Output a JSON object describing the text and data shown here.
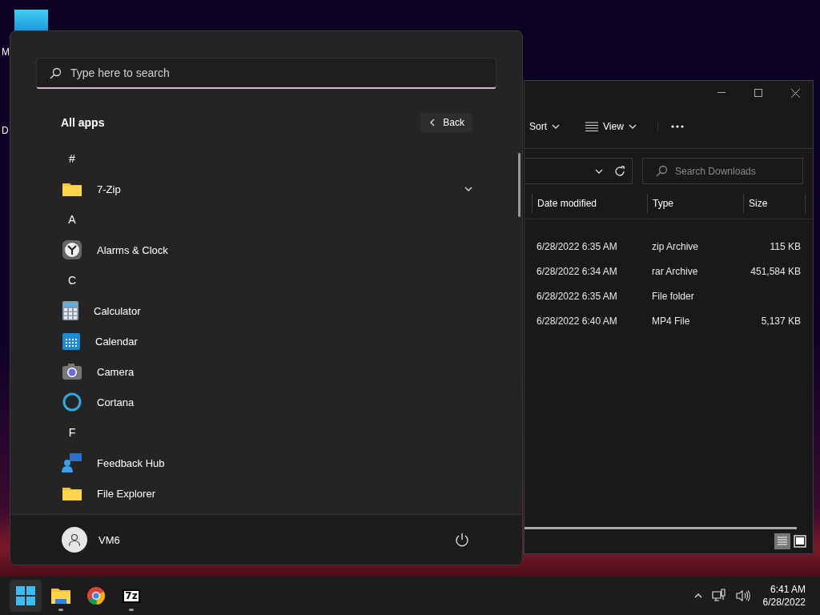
{
  "desktop": {
    "icons": [
      {
        "label": "M"
      },
      {
        "label": "D"
      }
    ]
  },
  "start_menu": {
    "search": {
      "placeholder": "Type here to search"
    },
    "title": "All apps",
    "back_button": "Back",
    "items": [
      {
        "kind": "letter",
        "label": "#"
      },
      {
        "kind": "folder",
        "label": "7-Zip"
      },
      {
        "kind": "letter",
        "label": "A"
      },
      {
        "kind": "app",
        "label": "Alarms & Clock"
      },
      {
        "kind": "letter",
        "label": "C"
      },
      {
        "kind": "app",
        "label": "Calculator"
      },
      {
        "kind": "app",
        "label": "Calendar"
      },
      {
        "kind": "app",
        "label": "Camera"
      },
      {
        "kind": "app",
        "label": "Cortana"
      },
      {
        "kind": "letter",
        "label": "F"
      },
      {
        "kind": "app",
        "label": "Feedback Hub"
      },
      {
        "kind": "app",
        "label": "File Explorer"
      }
    ],
    "user": {
      "name": "VM6"
    }
  },
  "explorer": {
    "toolbar": [
      {
        "kind": "sort",
        "label": "Sort"
      },
      {
        "kind": "view",
        "label": "View"
      }
    ],
    "search": {
      "placeholder": "Search Downloads"
    },
    "columns": [
      "Date modified",
      "Type",
      "Size"
    ],
    "rows": [
      {
        "date": "6/28/2022 6:35 AM",
        "type": "zip Archive",
        "size": "115 KB"
      },
      {
        "date": "6/28/2022 6:34 AM",
        "type": "rar Archive",
        "size": "451,584 KB"
      },
      {
        "date": "6/28/2022 6:35 AM",
        "type": "File folder"
      },
      {
        "date": "6/28/2022 6:40 AM",
        "type": "MP4 File",
        "size": "5,137 KB"
      }
    ],
    "views": [
      {
        "kind": "details",
        "selected": true
      },
      {
        "kind": "tiles",
        "selected": false
      }
    ]
  },
  "taskbar": {
    "buttons": [
      {
        "kind": "start",
        "selected": true,
        "running": false
      },
      {
        "kind": "files",
        "selected": false,
        "running": true
      },
      {
        "kind": "browser",
        "selected": false,
        "running": false
      },
      {
        "kind": "archiver",
        "selected": false,
        "running": true
      }
    ],
    "archiver_label": "7z",
    "clock": {
      "time": "6:41 AM",
      "date": "6/28/2022"
    }
  }
}
